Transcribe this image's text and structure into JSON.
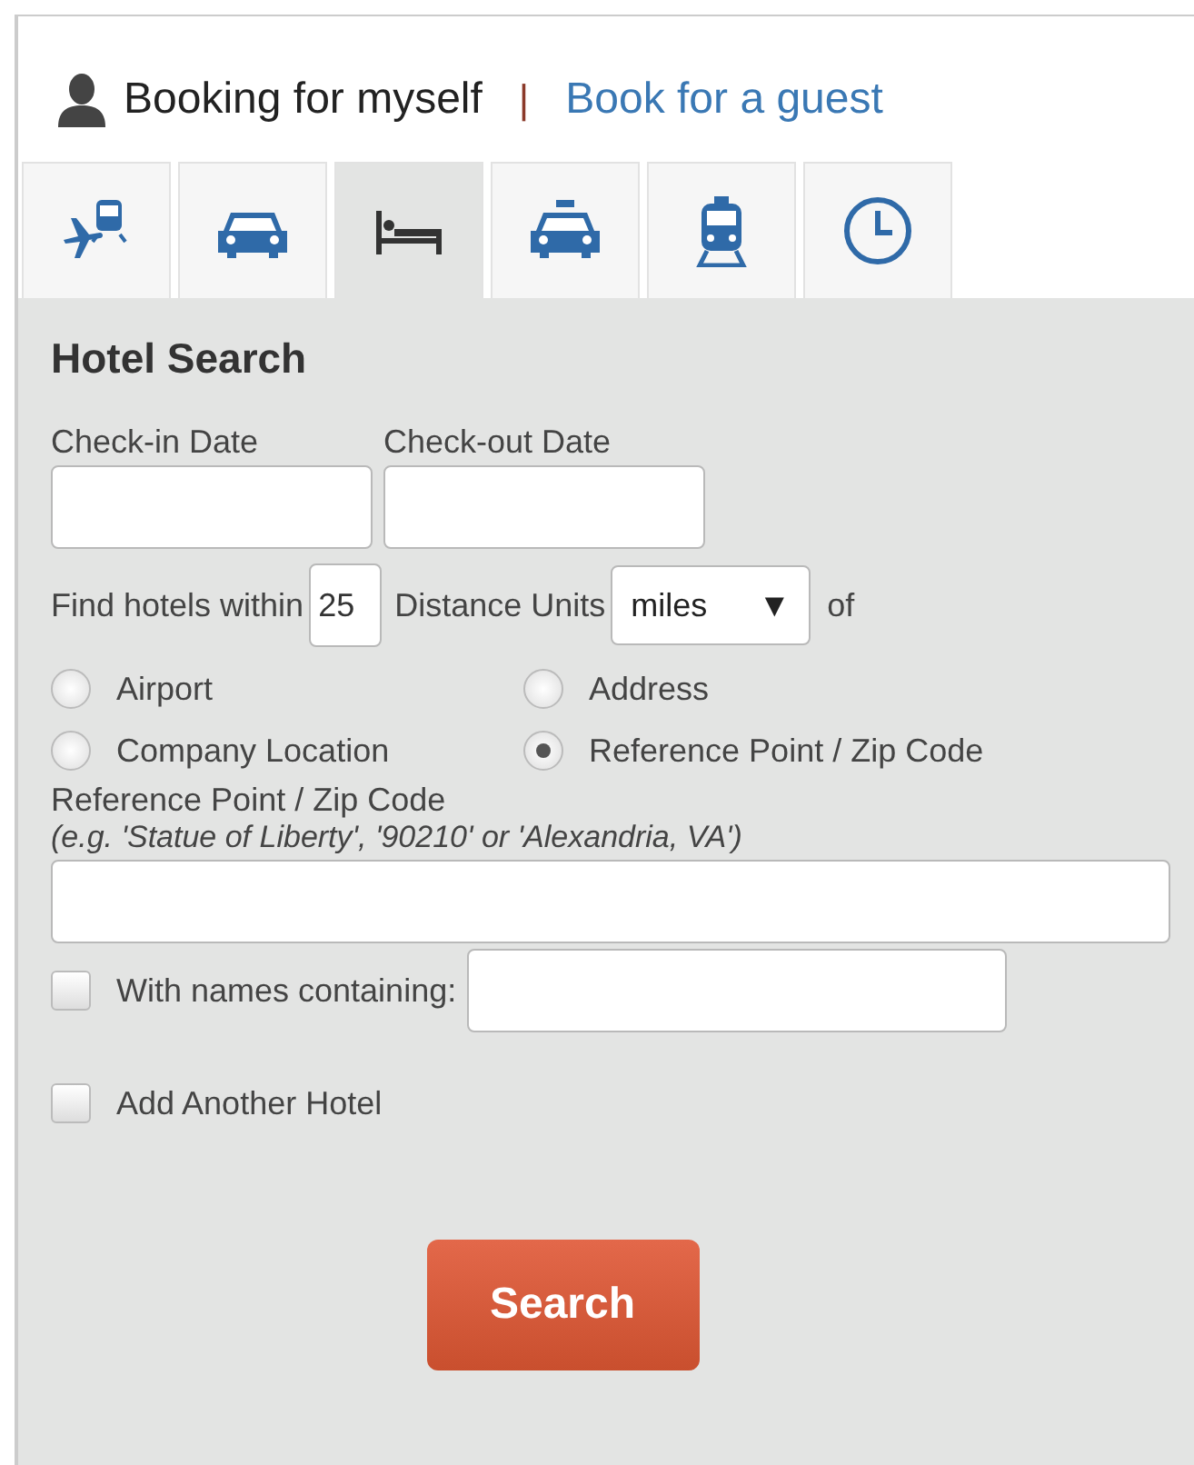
{
  "booking": {
    "self_label": "Booking for myself",
    "separator": "|",
    "guest_link": "Book for a guest"
  },
  "tabs": [
    {
      "kind": "flight-train",
      "selected": false
    },
    {
      "kind": "car",
      "selected": false
    },
    {
      "kind": "hotel",
      "selected": true
    },
    {
      "kind": "taxi",
      "selected": false
    },
    {
      "kind": "train",
      "selected": false
    },
    {
      "kind": "clock",
      "selected": false
    }
  ],
  "form": {
    "title": "Hotel Search",
    "check_in_label": "Check-in Date",
    "check_out_label": "Check-out Date",
    "within_label": "Find hotels within",
    "within_value": "25",
    "units_label": "Distance Units",
    "units_value": "miles",
    "units_caret": "▼",
    "of_label": "of",
    "location_options": [
      {
        "label": "Airport",
        "selected": false
      },
      {
        "label": "Address",
        "selected": false
      },
      {
        "label": "Company Location",
        "selected": false
      },
      {
        "label": "Reference Point / Zip Code",
        "selected": true
      }
    ],
    "reference_label": "Reference Point / Zip Code",
    "reference_hint": "(e.g. 'Statue of Liberty', '90210' or 'Alexandria, VA')",
    "names_option": {
      "label": "With names containing:",
      "checked": false
    },
    "another_hotel": {
      "label": "Add Another Hotel",
      "checked": false
    },
    "search_button": "Search"
  }
}
